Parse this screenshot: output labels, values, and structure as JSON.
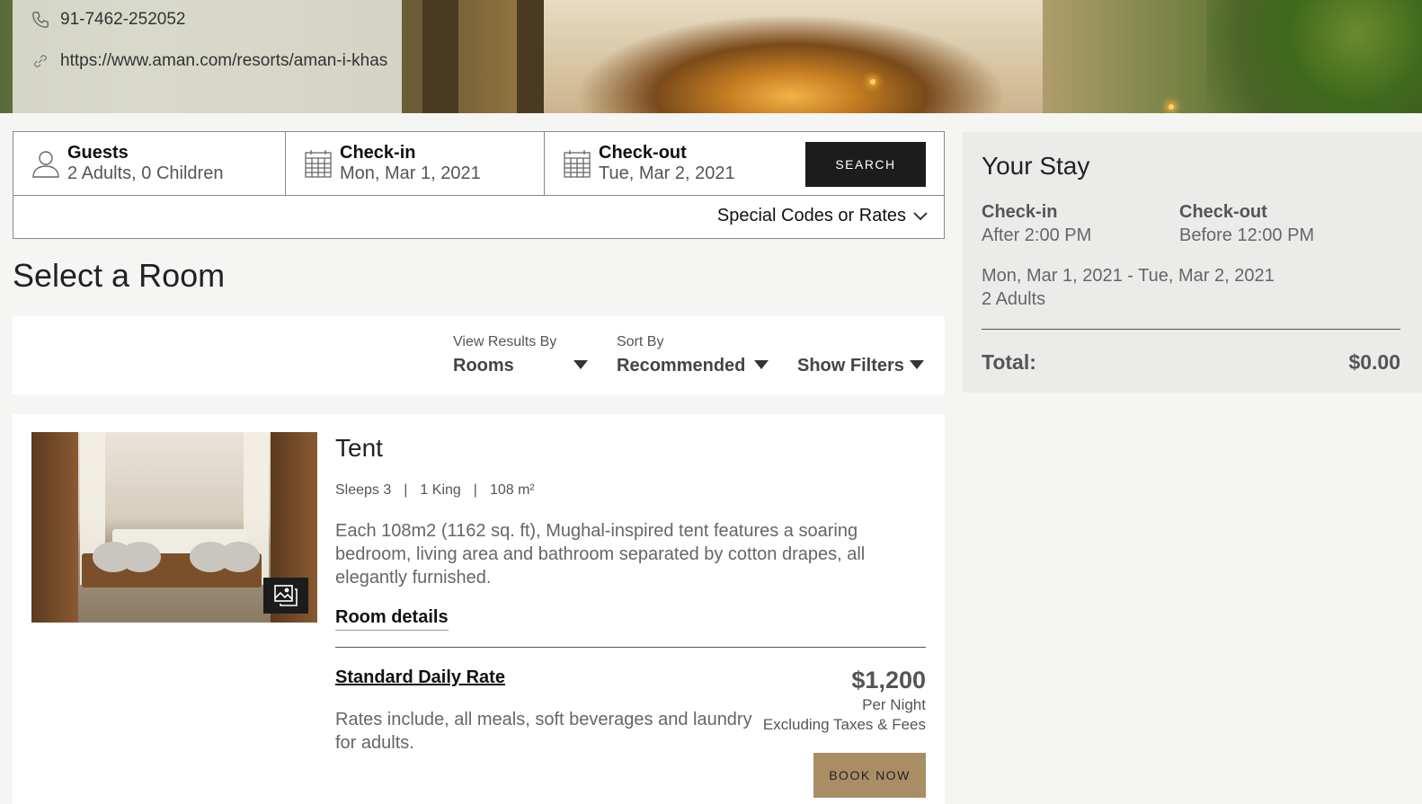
{
  "contact": {
    "phone": "91-7462-252052",
    "website": "https://www.aman.com/resorts/aman-i-khas"
  },
  "search": {
    "guests_label": "Guests",
    "guests_value": "2 Adults, 0 Children",
    "checkin_label": "Check-in",
    "checkin_value": "Mon, Mar 1, 2021",
    "checkout_label": "Check-out",
    "checkout_value": "Tue, Mar 2, 2021",
    "search_button": "SEARCH",
    "special_codes": "Special Codes or Rates"
  },
  "page_title": "Select a Room",
  "filters": {
    "view_label": "View Results By",
    "view_value": "Rooms",
    "sort_label": "Sort By",
    "sort_value": "Recommended",
    "show_filters": "Show Filters"
  },
  "room": {
    "name": "Tent",
    "sleeps": "Sleeps 3",
    "bed": "1 King",
    "size": "108 m²",
    "spec_separator": "|",
    "description": "Each 108m2 (1162 sq. ft), Mughal-inspired tent features a soaring bedroom, living area and bathroom separated by cotton drapes, all elegantly furnished.",
    "details_link": "Room details",
    "rate_name": "Standard Daily Rate",
    "rate_description": "Rates include, all meals, soft beverages and laundry for adults.",
    "price": "$1,200",
    "price_unit": "Per Night",
    "price_note": "Excluding Taxes & Fees",
    "book_button": "BOOK NOW"
  },
  "stay": {
    "title": "Your Stay",
    "checkin_label": "Check-in",
    "checkin_value": "After 2:00 PM",
    "checkout_label": "Check-out",
    "checkout_value": "Before 12:00 PM",
    "dates": "Mon, Mar 1, 2021 - Tue, Mar 2, 2021",
    "adults": "2 Adults",
    "total_label": "Total:",
    "total_value": "$0.00"
  },
  "icons": {
    "phone": "phone-icon",
    "link": "link-icon",
    "guest": "user-icon",
    "calendar": "calendar-icon",
    "chevron": "chevron-down-icon",
    "caret": "caret-down-icon",
    "gallery": "gallery-icon"
  },
  "colors": {
    "search_button_bg": "#1c1c1c",
    "book_button_bg": "#a98e65",
    "panel_bg": "#ebebea"
  }
}
